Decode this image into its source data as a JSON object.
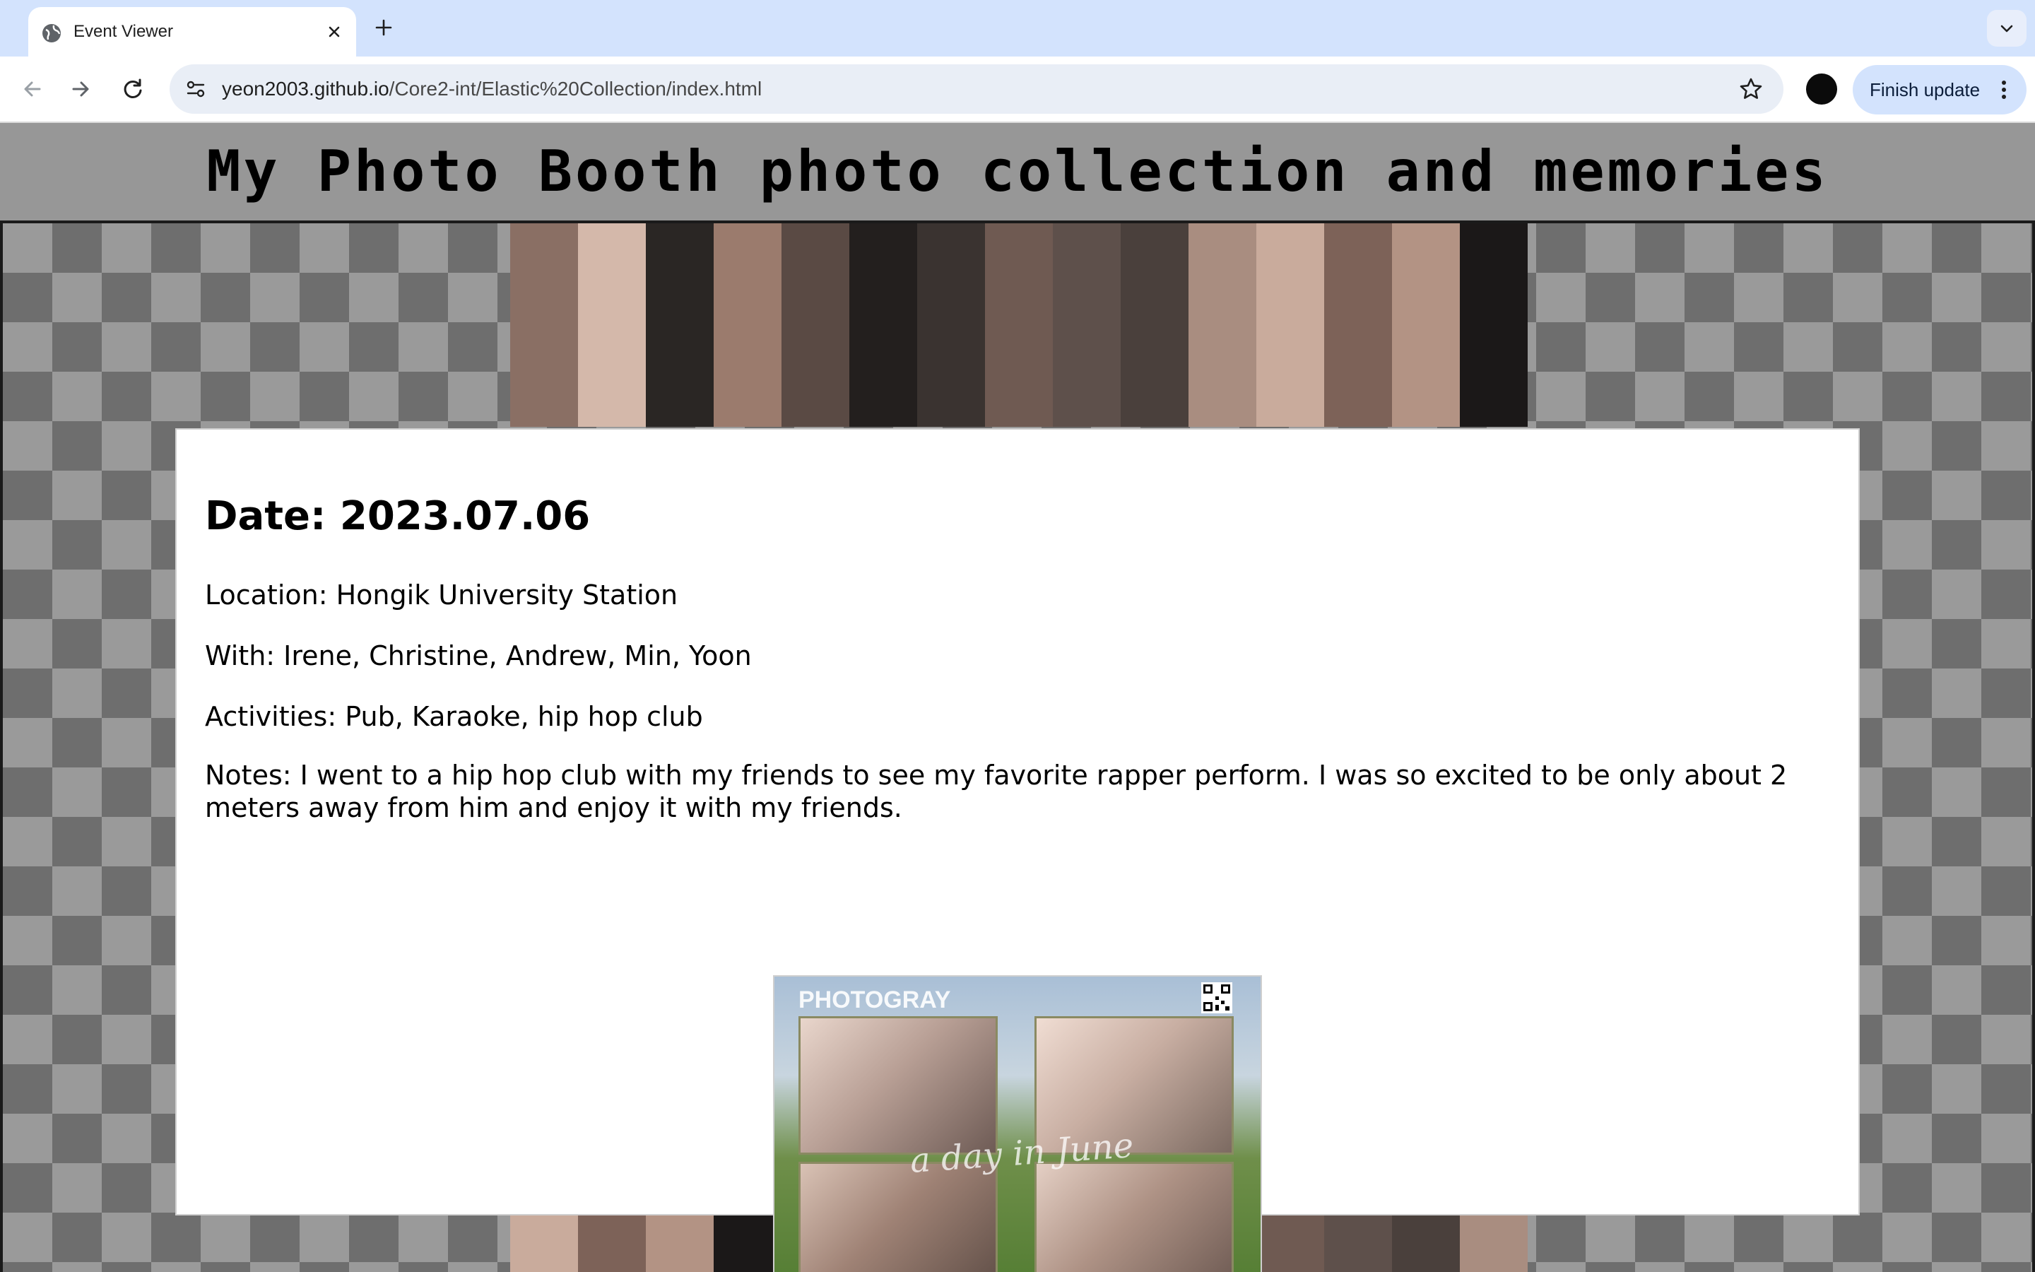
{
  "browser": {
    "tab_title": "Event Viewer",
    "url_host": "yeon2003.github.io",
    "url_path": "/Core2-int/Elastic%20Collection/index.html",
    "finish_update_label": "Finish update",
    "accent": "#d3e3fd"
  },
  "page": {
    "title": "My Photo Booth photo collection and memories",
    "header_color": "#979797"
  },
  "event": {
    "date": "Date: 2023.07.06",
    "location": "Location: Hongik University Station",
    "with": "With: Irene, Christine, Andrew, Min, Yoon",
    "activities": "Activities: Pub, Karaoke, hip hop club",
    "notes": "Notes: I went to a hip hop club with my friends to see my favorite rapper perform. I was so excited to be only about 2 meters away from him and enjoy it with my friends."
  },
  "photo": {
    "brand": "PHOTOGRAY",
    "caption": "a day in June"
  },
  "icons": [
    "globe-icon",
    "close-icon",
    "plus-icon",
    "chevron-down-icon",
    "back-arrow-icon",
    "forward-arrow-icon",
    "reload-icon",
    "site-info-icon",
    "star-icon",
    "more-vert-icon"
  ]
}
